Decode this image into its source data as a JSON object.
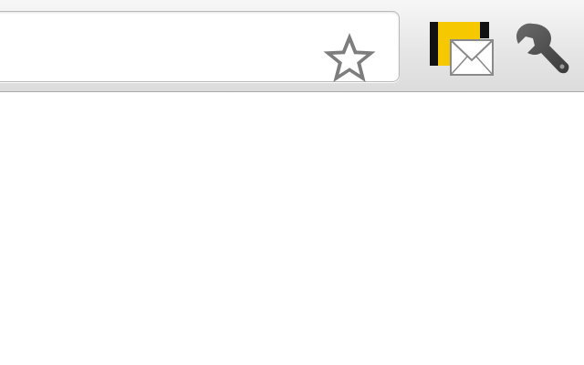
{
  "toolbar": {
    "omnibox": {
      "value": "",
      "placeholder": ""
    },
    "bookmark_star": {
      "icon": "star-icon"
    },
    "mail_extension": {
      "icon": "mail-extension-icon",
      "colors": {
        "yellow": "#f5c800",
        "black": "#111111"
      }
    },
    "settings_menu": {
      "icon": "wrench-icon"
    }
  },
  "content": {}
}
